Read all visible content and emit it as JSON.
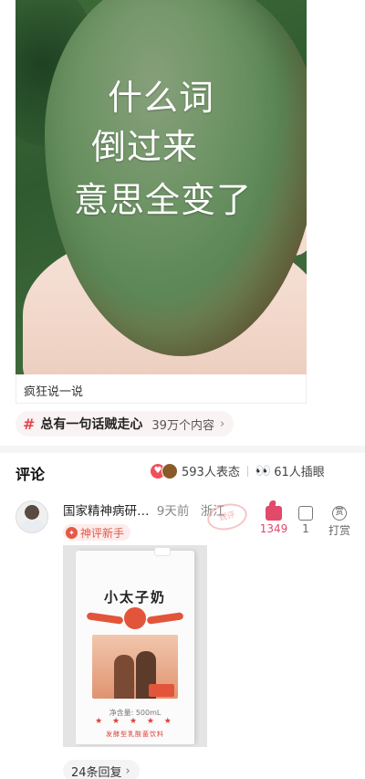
{
  "hero": {
    "caption_lines": [
      "什么词",
      "倒过来",
      "意思全变了"
    ]
  },
  "source": {
    "text": "疯狂说一说"
  },
  "topic": {
    "hash": "#",
    "title": "总有一句话贼走心",
    "count": "39万个内容",
    "chevron": "›"
  },
  "comments_header": {
    "title": "评论",
    "reactions_label": "593人表态",
    "peek_label": "61人插眼"
  },
  "comment": {
    "author": "国家精神病研…",
    "time": "9天前",
    "location": "浙江",
    "stamp": "锐评",
    "badge": "神评新手",
    "like_count": "1349",
    "dislike_count": "1",
    "tip_label": "打赏",
    "tip_icon_char": "赏",
    "milk": {
      "brand": "小太子奶",
      "net_content": "净含量: 500mL",
      "stars": "★ ★ ★ ★ ★",
      "footer": "发酵型乳酸菌饮料"
    },
    "replies_label": "24条回复",
    "replies_chevron": "›"
  },
  "colors": {
    "accent": "#e24a6a",
    "topic_hash": "#e2474f",
    "badge_text": "#e35a47"
  }
}
